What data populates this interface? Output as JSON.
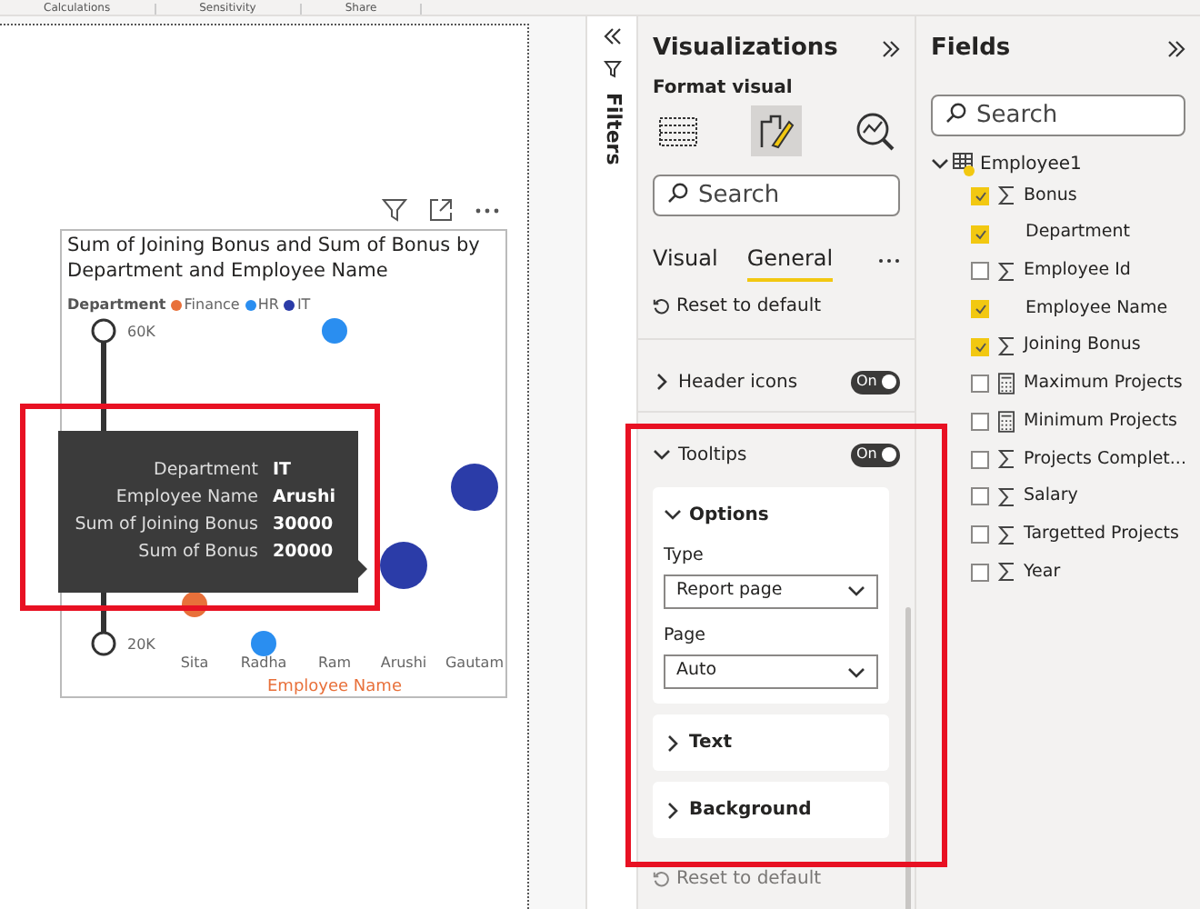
{
  "ribbon_tabs": [
    "Calculations",
    "Sensitivity",
    "Share"
  ],
  "visual": {
    "title": "Sum of Joining Bonus and Sum of Bonus by Department and Employee Name",
    "legend_title": "Department",
    "chart_data": {
      "type": "scatter",
      "xlabel": "Employee Name",
      "categories": [
        "Sita",
        "Radha",
        "Ram",
        "Arushi",
        "Gautam"
      ],
      "series": [
        {
          "name": "Finance",
          "color": "#e8703a",
          "values": [
            25000,
            null,
            null,
            null,
            null
          ]
        },
        {
          "name": "HR",
          "color": "#2a8ef0",
          "values": [
            null,
            20000,
            60000,
            null,
            null
          ]
        },
        {
          "name": "IT",
          "color": "#2b3ca8",
          "values": [
            null,
            null,
            null,
            30000,
            40000
          ]
        }
      ],
      "ylim": [
        20000,
        60000
      ],
      "yticks": [
        {
          "value": 60000,
          "label": "60K"
        },
        {
          "value": 20000,
          "label": "20K"
        }
      ]
    },
    "tooltip": [
      {
        "label": "Department",
        "value": "IT"
      },
      {
        "label": "Employee Name",
        "value": "Arushi"
      },
      {
        "label": "Sum of Joining Bonus",
        "value": "30000"
      },
      {
        "label": "Sum of Bonus",
        "value": "20000"
      }
    ]
  },
  "filters_pane": {
    "label": "Filters"
  },
  "visualizations": {
    "title": "Visualizations",
    "subtitle": "Format visual",
    "panes": [
      {
        "kind": "build",
        "selected": false
      },
      {
        "kind": "format",
        "selected": true
      },
      {
        "kind": "analytics",
        "selected": false
      }
    ],
    "search": {
      "placeholder": "Search"
    },
    "tabs": [
      {
        "label": "Visual",
        "selected": false
      },
      {
        "label": "General",
        "selected": true
      }
    ],
    "reset": "Reset to default",
    "sections": [
      {
        "label": "Header icons",
        "expanded": false,
        "toggle": "On",
        "on": true
      },
      {
        "label": "Tooltips",
        "expanded": true,
        "toggle": "On",
        "on": true
      }
    ],
    "cards": [
      {
        "label": "Options",
        "expanded": true,
        "fields": [
          {
            "label": "Type",
            "value": "Report page"
          },
          {
            "label": "Page",
            "value": "Auto"
          }
        ]
      },
      {
        "label": "Text",
        "expanded": false
      },
      {
        "label": "Background",
        "expanded": false
      }
    ],
    "footer_reset": "Reset to default"
  },
  "fields": {
    "title": "Fields",
    "search": {
      "placeholder": "Search"
    },
    "table": {
      "name": "Employee1",
      "expanded": true,
      "children": [
        {
          "name": "Bonus",
          "checked": true,
          "kind": "sum"
        },
        {
          "name": "Department",
          "checked": true,
          "kind": "text"
        },
        {
          "name": "Employee Id",
          "checked": false,
          "kind": "sum"
        },
        {
          "name": "Employee Name",
          "checked": true,
          "kind": "text"
        },
        {
          "name": "Joining Bonus",
          "checked": true,
          "kind": "sum"
        },
        {
          "name": "Maximum Projects",
          "checked": false,
          "kind": "calc"
        },
        {
          "name": "Minimum Projects",
          "checked": false,
          "kind": "calc"
        },
        {
          "name": "Projects Complet...",
          "checked": false,
          "kind": "sum"
        },
        {
          "name": "Salary",
          "checked": false,
          "kind": "sum"
        },
        {
          "name": "Targetted Projects",
          "checked": false,
          "kind": "sum"
        },
        {
          "name": "Year",
          "checked": false,
          "kind": "sum"
        }
      ]
    }
  }
}
